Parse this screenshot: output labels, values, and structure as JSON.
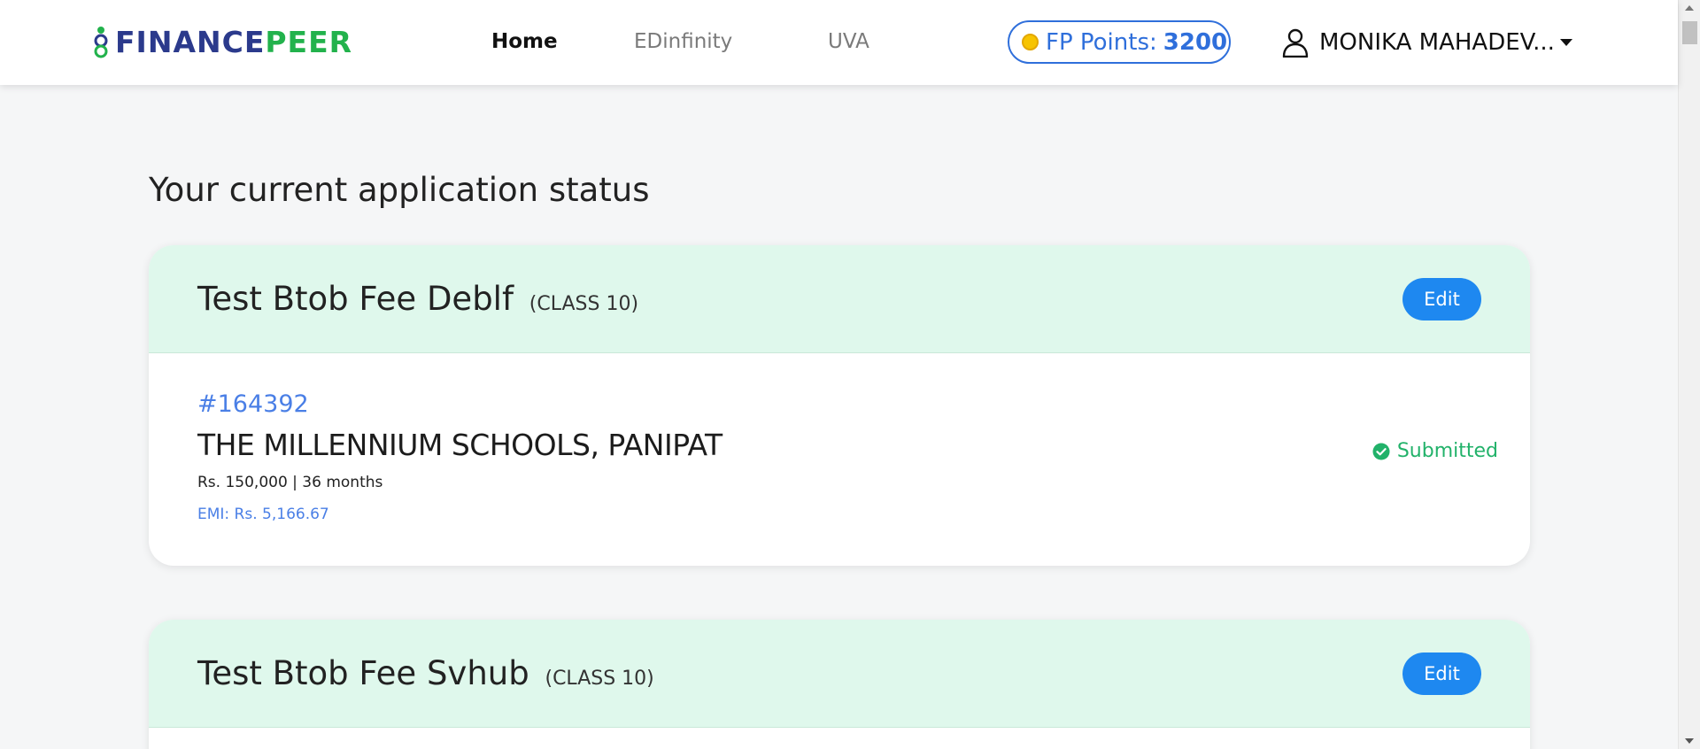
{
  "header": {
    "logo": {
      "part1": "FINANCE",
      "part2": "PEER"
    },
    "nav": [
      {
        "label": "Home",
        "active": true
      },
      {
        "label": "EDinfinity",
        "active": false
      },
      {
        "label": "UVA",
        "active": false
      }
    ],
    "points": {
      "label": "FP Points:",
      "value": "3200"
    },
    "user": {
      "name": "MONIKA MAHADEV..."
    }
  },
  "main": {
    "title": "Your current application status",
    "applications": [
      {
        "title": "Test Btob Fee Deblf",
        "class_label": "(CLASS 10)",
        "edit_label": "Edit",
        "id": "#164392",
        "school": "THE MILLENNIUM SCHOOLS, PANIPAT",
        "amount": "Rs. 150,000 | 36 months",
        "emi": "EMI: Rs. 5,166.67",
        "status": "Submitted"
      },
      {
        "title": "Test Btob Fee Svhub",
        "class_label": "(CLASS 10)",
        "edit_label": "Edit"
      }
    ]
  },
  "colors": {
    "brand_blue": "#2b3a8c",
    "brand_green": "#22b24c",
    "accent_blue": "#1e88f0",
    "card_header_bg": "#dff8ec",
    "status_green": "#22b26a"
  },
  "icons": [
    "logo-mark-icon",
    "coin-icon",
    "user-icon",
    "caret-down-icon",
    "check-circle-icon"
  ]
}
